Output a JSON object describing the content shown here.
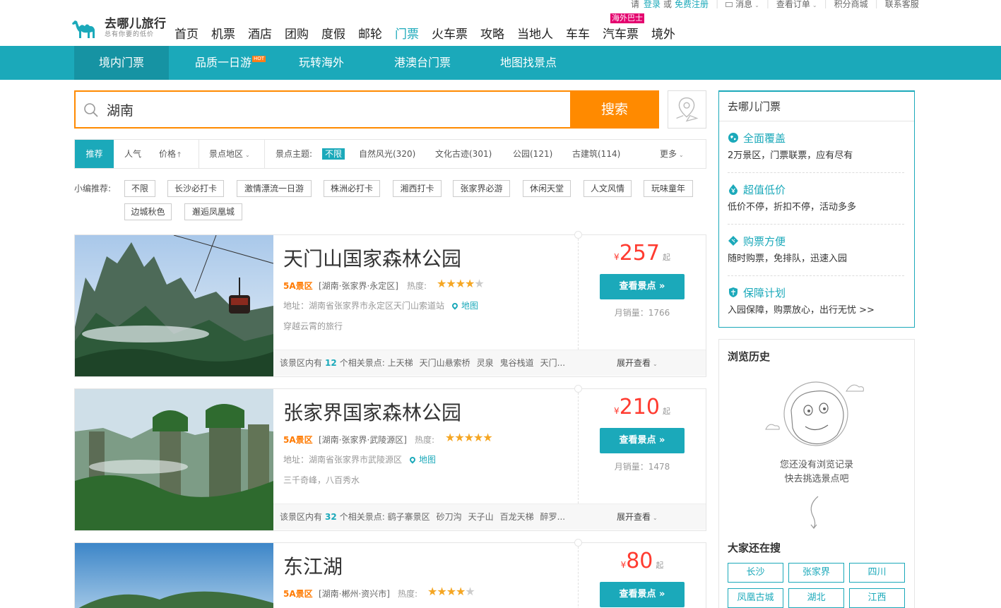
{
  "topbar": {
    "please": "请",
    "login": "登录",
    "or": "或",
    "register": "免费注册",
    "messages": "消息",
    "orders": "查看订单",
    "points_mall": "积分商城",
    "support": "联系客服"
  },
  "logo": {
    "name": "去哪儿旅行",
    "slogan": "总有你要的低价"
  },
  "mainnav": {
    "items": [
      "首页",
      "机票",
      "酒店",
      "团购",
      "度假",
      "邮轮",
      "门票",
      "火车票",
      "攻略",
      "当地人",
      "车车",
      "汽车票",
      "境外"
    ],
    "active": "门票",
    "bus_badge": "海外巴士"
  },
  "subnav": {
    "items": [
      "境内门票",
      "品质一日游",
      "玩转海外",
      "港澳台门票",
      "地图找景点"
    ],
    "hot_badge": "HOT"
  },
  "search": {
    "value": "湖南",
    "button": "搜索"
  },
  "filters": {
    "recommend": "推荐",
    "popular": "人气",
    "price": "价格",
    "area": "景点地区",
    "theme_label": "景点主题:",
    "theme_all": "不限",
    "themes": [
      "自然风光(320)",
      "文化古迹(301)",
      "公园(121)",
      "古建筑(114)"
    ],
    "more": "更多"
  },
  "editor_picks": {
    "label": "小编推荐:",
    "tags": [
      "不限",
      "长沙必打卡",
      "激情漂流一日游",
      "株洲必打卡",
      "湘西打卡",
      "张家界必游",
      "休闲天堂",
      "人文风情",
      "玩味童年",
      "边城秋色",
      "邂逅凤凰城"
    ]
  },
  "results": [
    {
      "name": "天门山国家森林公园",
      "level": "5A景区",
      "region": "[湖南·张家界·永定区]",
      "heat_label": "热度:",
      "rating": 4.5,
      "address": "地址：湖南省张家界市永定区天门山索道站",
      "map": "地图",
      "desc": "穿越云霄的旅行",
      "price_symbol": "¥",
      "price": "257",
      "price_suffix": "起",
      "btn": "查看景点 »",
      "sales": "月销量：1766",
      "related_prefix": "该景区内有",
      "related_count": "12",
      "related_suffix": "个相关景点:",
      "related": [
        "上天梯",
        "天门山悬索桥",
        "灵泉",
        "鬼谷栈道",
        "天门..."
      ],
      "expand": "展开查看"
    },
    {
      "name": "张家界国家森林公园",
      "level": "5A景区",
      "region": "[湖南·张家界·武陵源区]",
      "heat_label": "热度:",
      "rating": 5,
      "address": "地址：湖南省张家界市武陵源区",
      "map": "地图",
      "desc": "三千奇峰，八百秀水",
      "price_symbol": "¥",
      "price": "210",
      "price_suffix": "起",
      "btn": "查看景点 »",
      "sales": "月销量：1478",
      "related_prefix": "该景区内有",
      "related_count": "32",
      "related_suffix": "个相关景点:",
      "related": [
        "鹞子寨景区",
        "砂刀沟",
        "天子山",
        "百龙天梯",
        "醉罗..."
      ],
      "expand": "展开查看"
    },
    {
      "name": "东江湖",
      "level": "5A景区",
      "region": "[湖南·郴州·资兴市]",
      "heat_label": "热度:",
      "rating": 4.5,
      "price_symbol": "¥",
      "price": "80",
      "price_suffix": "起",
      "btn": "查看景点 »"
    }
  ],
  "sidebar": {
    "title": "去哪儿门票",
    "features": [
      {
        "icon": "globe-icon",
        "title": "全面覆盖",
        "desc": "2万景区，门票联票，应有尽有"
      },
      {
        "icon": "yen-drop-icon",
        "title": "超值低价",
        "desc": "低价不停，折扣不停，活动多多"
      },
      {
        "icon": "ticket-icon",
        "title": "购票方便",
        "desc": "随时购票，免排队，迅速入园"
      },
      {
        "icon": "shield-icon",
        "title": "保障计划",
        "desc": "入园保障，购票放心，出行无忧 >>"
      }
    ],
    "history_title": "浏览历史",
    "history_empty_1": "您还没有浏览记录",
    "history_empty_2": "快去挑选景点吧",
    "hot_title": "大家还在搜",
    "hot_keywords": [
      "长沙",
      "张家界",
      "四川",
      "凤凰古城",
      "湖北",
      "江西"
    ]
  },
  "colors": {
    "accent": "#1ba9ba",
    "orange": "#ff8a00",
    "price": "#ff3b30",
    "star": "#f5a623"
  }
}
